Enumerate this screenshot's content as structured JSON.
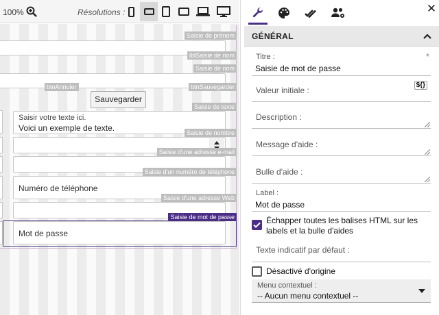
{
  "toolbar": {
    "zoom": "100%",
    "resolutions_label": "Résolutions :",
    "devices": [
      "phone-portrait",
      "phone-landscape",
      "tablet-portrait",
      "tablet-landscape",
      "laptop",
      "desktop"
    ]
  },
  "canvas": {
    "tags": {
      "prenom": "Saisie de prénom",
      "lblnom": "lblSaisie de nom",
      "nom": "Saisie de nom",
      "annuler": "btnAnnuler",
      "sauvegarder_ctrl": "btnSauvegarder",
      "texte": "Saisie de texte",
      "nombre": "Saisie de nombre",
      "email": "Saisie d'une adresse e-mail",
      "telephone": "Saisie d'un numéro de téléphone",
      "web": "Saisie d'une adresse Web",
      "motdepasse": "Saisie de mot de passe"
    },
    "save_button": "Sauvegarder",
    "textarea_placeholder": "Saisir votre texte ici.",
    "textarea_value": "Voici un exemple de texte.",
    "phone_placeholder": "Numéro de téléphone",
    "password_placeholder": "Mot de passe"
  },
  "panel": {
    "tabs": [
      "wrench-icon",
      "palette-icon",
      "double-check-icon",
      "users-gear-icon"
    ],
    "section_title": "GÉNÉRAL",
    "fields": {
      "titre_label": "Titre :",
      "titre_value": "Saisie de mot de passe",
      "required_mark": "*",
      "valeur_initiale_label": "Valeur initiale :",
      "expr_badge": "${}",
      "description_label": "Description :",
      "message_aide_label": "Message d'aide :",
      "bulle_aide_label": "Bulle d'aide :",
      "label_label": "Label :",
      "label_value": "Mot de passe",
      "echapper_label_1": "Échapper toutes les balises HTML sur les",
      "echapper_label_2": "labels et la bulle d'aides",
      "echapper_checked": true,
      "texte_indicatif_label": "Texte indicatif par défaut :",
      "desactive_label": "Désactivé d'origine",
      "desactive_checked": false,
      "menu_label": "Menu contextuel :",
      "menu_value": "-- Aucun menu contextuel --"
    }
  },
  "colors": {
    "accent": "#4a2e86",
    "tag_gray": "#bdbdbd"
  }
}
